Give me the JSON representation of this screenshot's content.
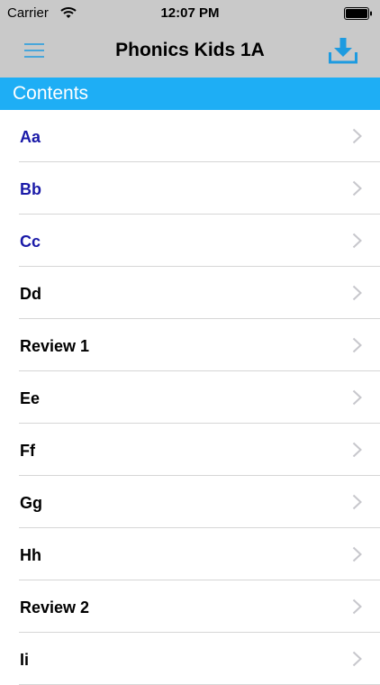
{
  "status_bar": {
    "carrier": "Carrier",
    "time": "12:07 PM"
  },
  "nav_bar": {
    "title": "Phonics Kids 1A",
    "menu_icon": "hamburger-menu-icon",
    "download_icon": "download-icon"
  },
  "section": {
    "title": "Contents"
  },
  "colors": {
    "bar_gray": "#c9c9c9",
    "header_blue": "#1eaef5",
    "visited_text": "#1a1aa8",
    "icon_blue": "#1e9be0"
  },
  "items": [
    {
      "label": "Aa",
      "visited": true
    },
    {
      "label": "Bb",
      "visited": true
    },
    {
      "label": "Cc",
      "visited": true
    },
    {
      "label": "Dd",
      "visited": false
    },
    {
      "label": "Review 1",
      "visited": false
    },
    {
      "label": "Ee",
      "visited": false
    },
    {
      "label": "Ff",
      "visited": false
    },
    {
      "label": "Gg",
      "visited": false
    },
    {
      "label": "Hh",
      "visited": false
    },
    {
      "label": "Review 2",
      "visited": false
    },
    {
      "label": "Ii",
      "visited": false
    }
  ]
}
